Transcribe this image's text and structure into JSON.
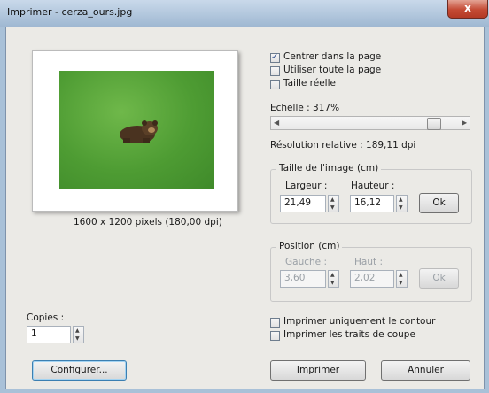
{
  "window": {
    "title": "Imprimer - cerza_ours.jpg",
    "close_glyph": "x"
  },
  "preview": {
    "caption": "1600 x 1200 pixels (180,00 dpi)"
  },
  "options": [
    {
      "label": "Centrer dans la page",
      "checked": true
    },
    {
      "label": "Utiliser toute la page",
      "checked": false
    },
    {
      "label": "Taille réelle",
      "checked": false
    }
  ],
  "scale": {
    "label": "Echelle : 317%",
    "relative_resolution": "Résolution relative : 189,11 dpi"
  },
  "image_size": {
    "group_title": "Taille de l'image (cm)",
    "width_label": "Largeur :",
    "width_value": "21,49",
    "height_label": "Hauteur :",
    "height_value": "16,12",
    "ok_label": "Ok"
  },
  "position": {
    "group_title": "Position (cm)",
    "left_label": "Gauche :",
    "left_value": "3,60",
    "top_label": "Haut :",
    "top_value": "2,02",
    "ok_label": "Ok"
  },
  "copies": {
    "label": "Copies :",
    "value": "1"
  },
  "print_options": [
    {
      "label": "Imprimer uniquement le contour",
      "checked": false
    },
    {
      "label": "Imprimer les traits de coupe",
      "checked": false
    }
  ],
  "buttons": {
    "configure": "Configurer...",
    "print": "Imprimer",
    "cancel": "Annuler"
  },
  "colors": {
    "accent": "#3c7fb1",
    "close": "#c44a34",
    "grass": "#4e9c33"
  }
}
